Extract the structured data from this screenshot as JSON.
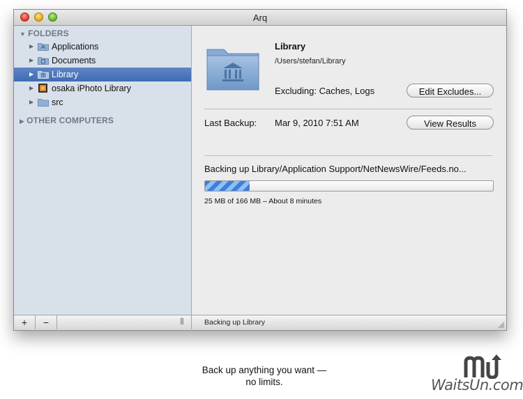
{
  "window": {
    "title": "Arq"
  },
  "sidebar": {
    "folders_header": "FOLDERS",
    "other_header": "OTHER COMPUTERS",
    "items": [
      {
        "label": "Applications",
        "icon": "applications-folder-icon"
      },
      {
        "label": "Documents",
        "icon": "documents-folder-icon"
      },
      {
        "label": "Library",
        "icon": "library-folder-icon",
        "selected": true
      },
      {
        "label": "osaka iPhoto Library",
        "icon": "iphoto-library-icon"
      },
      {
        "label": "src",
        "icon": "folder-icon"
      }
    ]
  },
  "detail": {
    "name": "Library",
    "path": "/Users/stefan/Library",
    "excluding": "Excluding: Caches, Logs",
    "edit_excludes_label": "Edit Excludes...",
    "last_backup_label": "Last Backup:",
    "last_backup_value": "Mar 9, 2010 7:51 AM",
    "view_results_label": "View Results",
    "backing_up_text": "Backing up Library/Application Support/NetNewsWire/Feeds.no...",
    "progress_text": "25 MB of 166 MB – About 8 minutes",
    "progress_fraction": 0.155
  },
  "bottombar": {
    "add_label": "+",
    "remove_label": "−",
    "status": "Backing up Library"
  },
  "caption": {
    "line1": "Back up anything you want —",
    "line2": "no limits."
  },
  "watermark": {
    "text": "WaitsUn.com"
  },
  "colors": {
    "selection": "#4a74bd",
    "sidebar": "#d8e0ea",
    "progress": "#3e7fdb"
  }
}
